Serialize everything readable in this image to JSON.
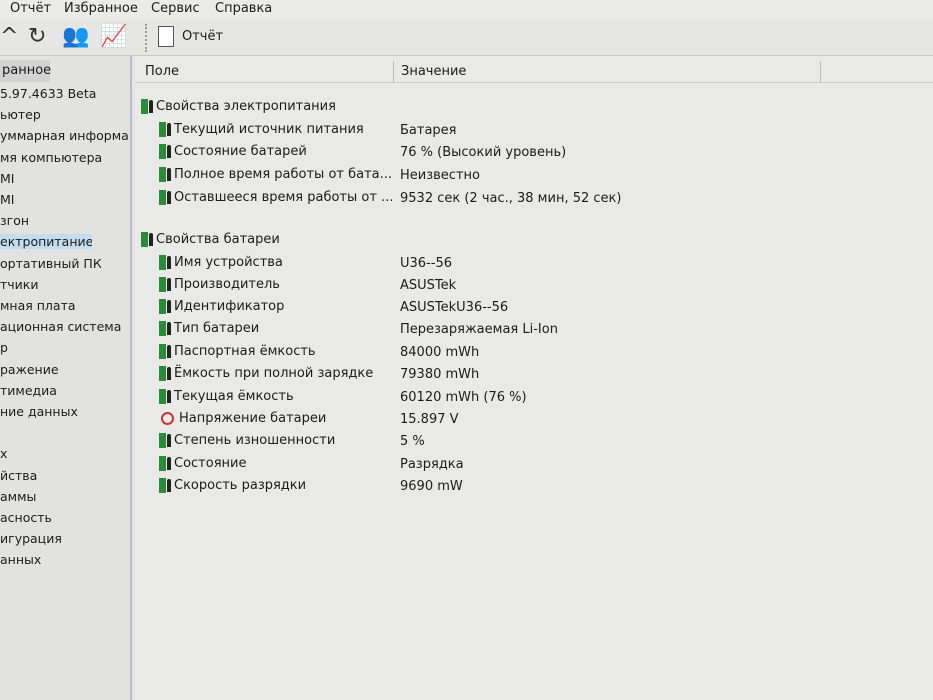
{
  "menu": [
    "Отчёт",
    "Избранное",
    "Сервис",
    "Справка"
  ],
  "toolbar": {
    "report_label": "Отчёт"
  },
  "left": {
    "tab": "ранное",
    "items": [
      "5.97.4633 Beta",
      "ьютер",
      "уммарная информа",
      "мя компьютера",
      "MI",
      "MI",
      "згон",
      "ектропитание",
      "ортативный ПК",
      "тчики",
      "мная плата",
      "ационная система",
      "р",
      "ражение",
      "тимедиа",
      "ние данных",
      "",
      "х",
      "йства",
      "аммы",
      "асность",
      "игурация",
      "анных"
    ],
    "selected": 7
  },
  "columns": {
    "field": "Поле",
    "value": "Значение"
  },
  "groups": [
    {
      "title": "Свойства электропитания",
      "rows": [
        {
          "field": "Текущий источник питания",
          "value": "Батарея"
        },
        {
          "field": "Состояние батарей",
          "value": "76 % (Высокий уровень)"
        },
        {
          "field": "Полное время работы от бата...",
          "value": "Неизвестно"
        },
        {
          "field": "Оставшееся время работы от ...",
          "value": "9532 сек (2 час., 38 мин, 52 сек)"
        }
      ]
    },
    {
      "title": "Свойства батареи",
      "rows": [
        {
          "field": "Имя устройства",
          "value": "U36--56"
        },
        {
          "field": "Производитель",
          "value": "ASUSTek"
        },
        {
          "field": "Идентификатор",
          "value": "ASUSTekU36--56"
        },
        {
          "field": "Тип батареи",
          "value": "Перезаряжаемая Li-Ion"
        },
        {
          "field": "Паспортная ёмкость",
          "value": "84000 mWh"
        },
        {
          "field": "Ёмкость при полной зарядке",
          "value": "79380 mWh"
        },
        {
          "field": "Текущая ёмкость",
          "value": "60120 mWh  (76 %)"
        },
        {
          "field": "Напряжение батареи",
          "value": "15.897 V",
          "icon": "voltage"
        },
        {
          "field": "Степень изношенности",
          "value": "5 %"
        },
        {
          "field": "Состояние",
          "value": "Разрядка"
        },
        {
          "field": "Скорость разрядки",
          "value": "9690 mW"
        }
      ]
    }
  ]
}
